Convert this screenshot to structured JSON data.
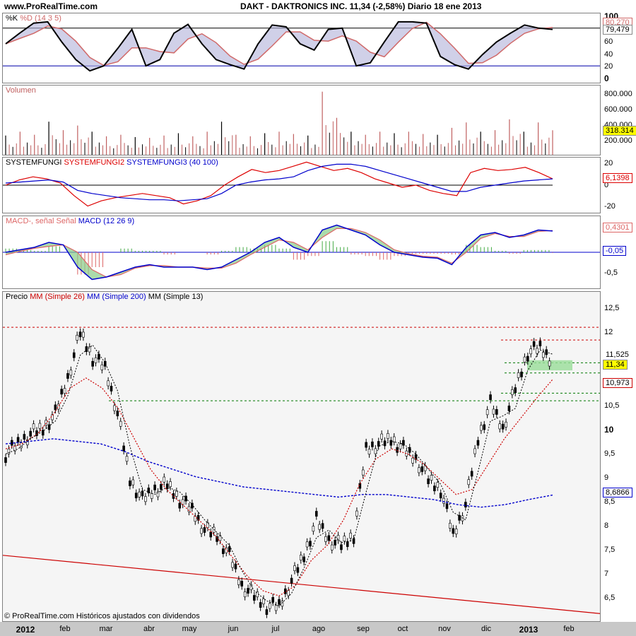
{
  "header": {
    "site": "www.ProRealTime.com",
    "title": "DAKT - DAKTRONICS INC.     11,34 (-2,58%)     Diario  18 ene 2013"
  },
  "stoch": {
    "label_k": "%K",
    "label_d": "%D (14 3 5)",
    "ticks": [
      "100",
      "80",
      "60",
      "40",
      "20",
      "0"
    ],
    "val1": "80,270",
    "val2": "79,479"
  },
  "volume": {
    "label": "Volumen",
    "ticks": [
      "800.000",
      "600.000",
      "400.000",
      "200.000"
    ],
    "val": "318.314"
  },
  "fungi": {
    "label1": "SYSTEMFUNGI",
    "label2": "SYSTEMFUNGI2",
    "label3": "SYSTEMFUNGI3 (40 100)",
    "ticks": [
      "20",
      "0",
      "-20"
    ],
    "val": "6,1398"
  },
  "macd": {
    "label1": "MACD-, señal Señal",
    "label2": "MACD (12 26 9)",
    "ticks": [
      "-0,5"
    ],
    "val1": "0,4301",
    "val2": "-0,05"
  },
  "price": {
    "label0": "Precio",
    "label1": "MM (Simple 26)",
    "label2": "MM (Simple 200)",
    "label3": "MM (Simple 13)",
    "ticks": [
      "12,5",
      "12",
      "11,5",
      "11",
      "10,5",
      "10",
      "9,5",
      "9",
      "8,5",
      "8",
      "7,5",
      "7",
      "6,5"
    ],
    "tag_last": "11,525",
    "tag_close": "11,34",
    "tag_ma26": "10,973",
    "tag_ma200": "8,6866"
  },
  "xaxis": {
    "labels": [
      "2012",
      "feb",
      "mar",
      "abr",
      "may",
      "jun",
      "jul",
      "ago",
      "sep",
      "oct",
      "nov",
      "dic",
      "2013",
      "feb"
    ]
  },
  "footer": {
    "credit": "© ProRealTime.com Históricos ajustados con dividendos"
  },
  "colors": {
    "candle": "#000000",
    "ma26": "#cc0000",
    "ma200": "#0000cc",
    "ma13": "#000000",
    "stoch_k": "#000000",
    "stoch_d": "#d06a6a",
    "volume": "#c06060",
    "fungi2": "#dd0000",
    "fungi3": "#0000cc",
    "macd_up": "#44aa44",
    "macd_down": "#dd6666",
    "highlight": "#ffff00"
  },
  "chart_data": [
    {
      "type": "line",
      "title": "%K %D (14 3 5)",
      "ylim": [
        0,
        100
      ],
      "series": [
        {
          "name": "%K",
          "values": [
            55,
            72,
            88,
            90,
            58,
            30,
            12,
            20,
            48,
            78,
            20,
            30,
            72,
            86,
            55,
            30,
            22,
            15,
            55,
            85,
            82,
            55,
            45,
            78,
            80,
            20,
            25,
            58,
            90,
            90,
            88,
            35,
            22,
            15,
            38,
            58,
            72,
            85,
            80,
            78
          ]
        }
      ]
    },
    {
      "type": "bar",
      "title": "Volumen",
      "ylim": [
        0,
        900000
      ],
      "series": [
        {
          "name": "Volumen",
          "values": [
            250000,
            300000,
            260000,
            430000,
            320000,
            380000,
            300000,
            240000,
            260000,
            230000,
            220000,
            250000,
            280000,
            240000,
            300000,
            430000,
            260000,
            240000,
            280000,
            300000,
            270000,
            250000,
            820000,
            480000,
            300000,
            260000,
            300000,
            280000,
            300000,
            270000,
            260000,
            350000,
            420000,
            300000,
            320000,
            460000,
            300000,
            420000,
            318314
          ]
        }
      ]
    },
    {
      "type": "line",
      "title": "SYSTEMFUNGI (40 100)",
      "ylim": [
        -25,
        25
      ],
      "series": [
        {
          "name": "SYSTEMFUNGI2",
          "values": [
            0,
            5,
            8,
            6,
            2,
            -10,
            -20,
            -15,
            -12,
            -10,
            -8,
            -10,
            -12,
            -18,
            -15,
            -10,
            0,
            8,
            15,
            12,
            14,
            18,
            22,
            18,
            14,
            16,
            12,
            6,
            2,
            -2,
            0,
            -5,
            -8,
            -10,
            12,
            16,
            14,
            15,
            17,
            12,
            6
          ]
        },
        {
          "name": "SYSTEMFUNGI3",
          "values": [
            2,
            3,
            4,
            5,
            3,
            -5,
            -8,
            -10,
            -12,
            -13,
            -14,
            -14,
            -15,
            -14,
            -13,
            -8,
            0,
            3,
            5,
            6,
            8,
            14,
            18,
            20,
            20,
            18,
            14,
            10,
            6,
            2,
            -2,
            -6,
            -6,
            -2,
            0,
            2,
            4,
            5,
            6
          ]
        }
      ]
    },
    {
      "type": "line",
      "title": "MACD (12 26 9)",
      "ylim": [
        -0.7,
        0.7
      ],
      "series": [
        {
          "name": "MACD",
          "values": [
            0,
            0.05,
            0.1,
            0.2,
            0.15,
            -0.3,
            -0.55,
            -0.5,
            -0.4,
            -0.3,
            -0.25,
            -0.3,
            -0.3,
            -0.3,
            -0.35,
            -0.3,
            -0.15,
            0,
            0.2,
            0.3,
            0.1,
            0.0,
            0.45,
            0.55,
            0.45,
            0.35,
            0.15,
            0.0,
            -0.05,
            -0.1,
            -0.12,
            -0.25,
            0.1,
            0.35,
            0.4,
            0.3,
            0.35,
            0.45,
            0.43
          ]
        },
        {
          "name": "Señal",
          "values": [
            -0.05,
            0.02,
            0.08,
            0.12,
            0.15,
            0.0,
            -0.35,
            -0.5,
            -0.45,
            -0.32,
            -0.27,
            -0.27,
            -0.3,
            -0.3,
            -0.32,
            -0.32,
            -0.22,
            -0.05,
            0.1,
            0.25,
            0.2,
            0.05,
            0.3,
            0.48,
            0.48,
            0.4,
            0.25,
            0.05,
            -0.03,
            -0.08,
            -0.1,
            -0.22,
            0.0,
            0.28,
            0.38,
            0.32,
            0.32,
            0.42,
            0.44
          ]
        }
      ]
    },
    {
      "type": "line",
      "title": "Precio MM (Simple 26) MM (Simple 200) MM (Simple 13)",
      "ylim": [
        6.2,
        12.7
      ],
      "series": [
        {
          "name": "Precio",
          "values": [
            9.5,
            9.7,
            9.9,
            10.0,
            10.3,
            11.0,
            11.9,
            11.4,
            11.2,
            10.3,
            9.0,
            8.6,
            8.8,
            8.9,
            8.6,
            8.4,
            8.0,
            7.9,
            7.5,
            6.9,
            6.7,
            6.5,
            6.5,
            7.0,
            7.5,
            8.2,
            7.8,
            7.7,
            7.9,
            9.6,
            9.7,
            9.8,
            9.6,
            9.4,
            9.0,
            8.8,
            7.9,
            8.5,
            9.8,
            10.5,
            10.0,
            10.8,
            11.5,
            11.6,
            11.34
          ]
        },
        {
          "name": "MM (Simple 26)",
          "values": [
            9.6,
            9.7,
            9.9,
            10.3,
            10.8,
            11.0,
            10.8,
            10.4,
            9.8,
            9.2,
            8.8,
            8.5,
            8.2,
            7.9,
            7.5,
            7.1,
            6.8,
            6.7,
            6.9,
            7.4,
            7.7,
            8.2,
            8.9,
            9.4,
            9.6,
            9.5,
            9.3,
            9.0,
            8.7,
            8.8,
            9.3,
            9.8,
            10.2,
            10.6,
            10.97
          ]
        },
        {
          "name": "MM (Simple 200)",
          "values": [
            9.7,
            9.75,
            9.8,
            9.75,
            9.7,
            9.55,
            9.35,
            9.2,
            9.05,
            8.95,
            8.85,
            8.8,
            8.75,
            8.7,
            8.65,
            8.7,
            8.7,
            8.65,
            8.6,
            8.5,
            8.45,
            8.5,
            8.6,
            8.69
          ]
        }
      ]
    }
  ]
}
